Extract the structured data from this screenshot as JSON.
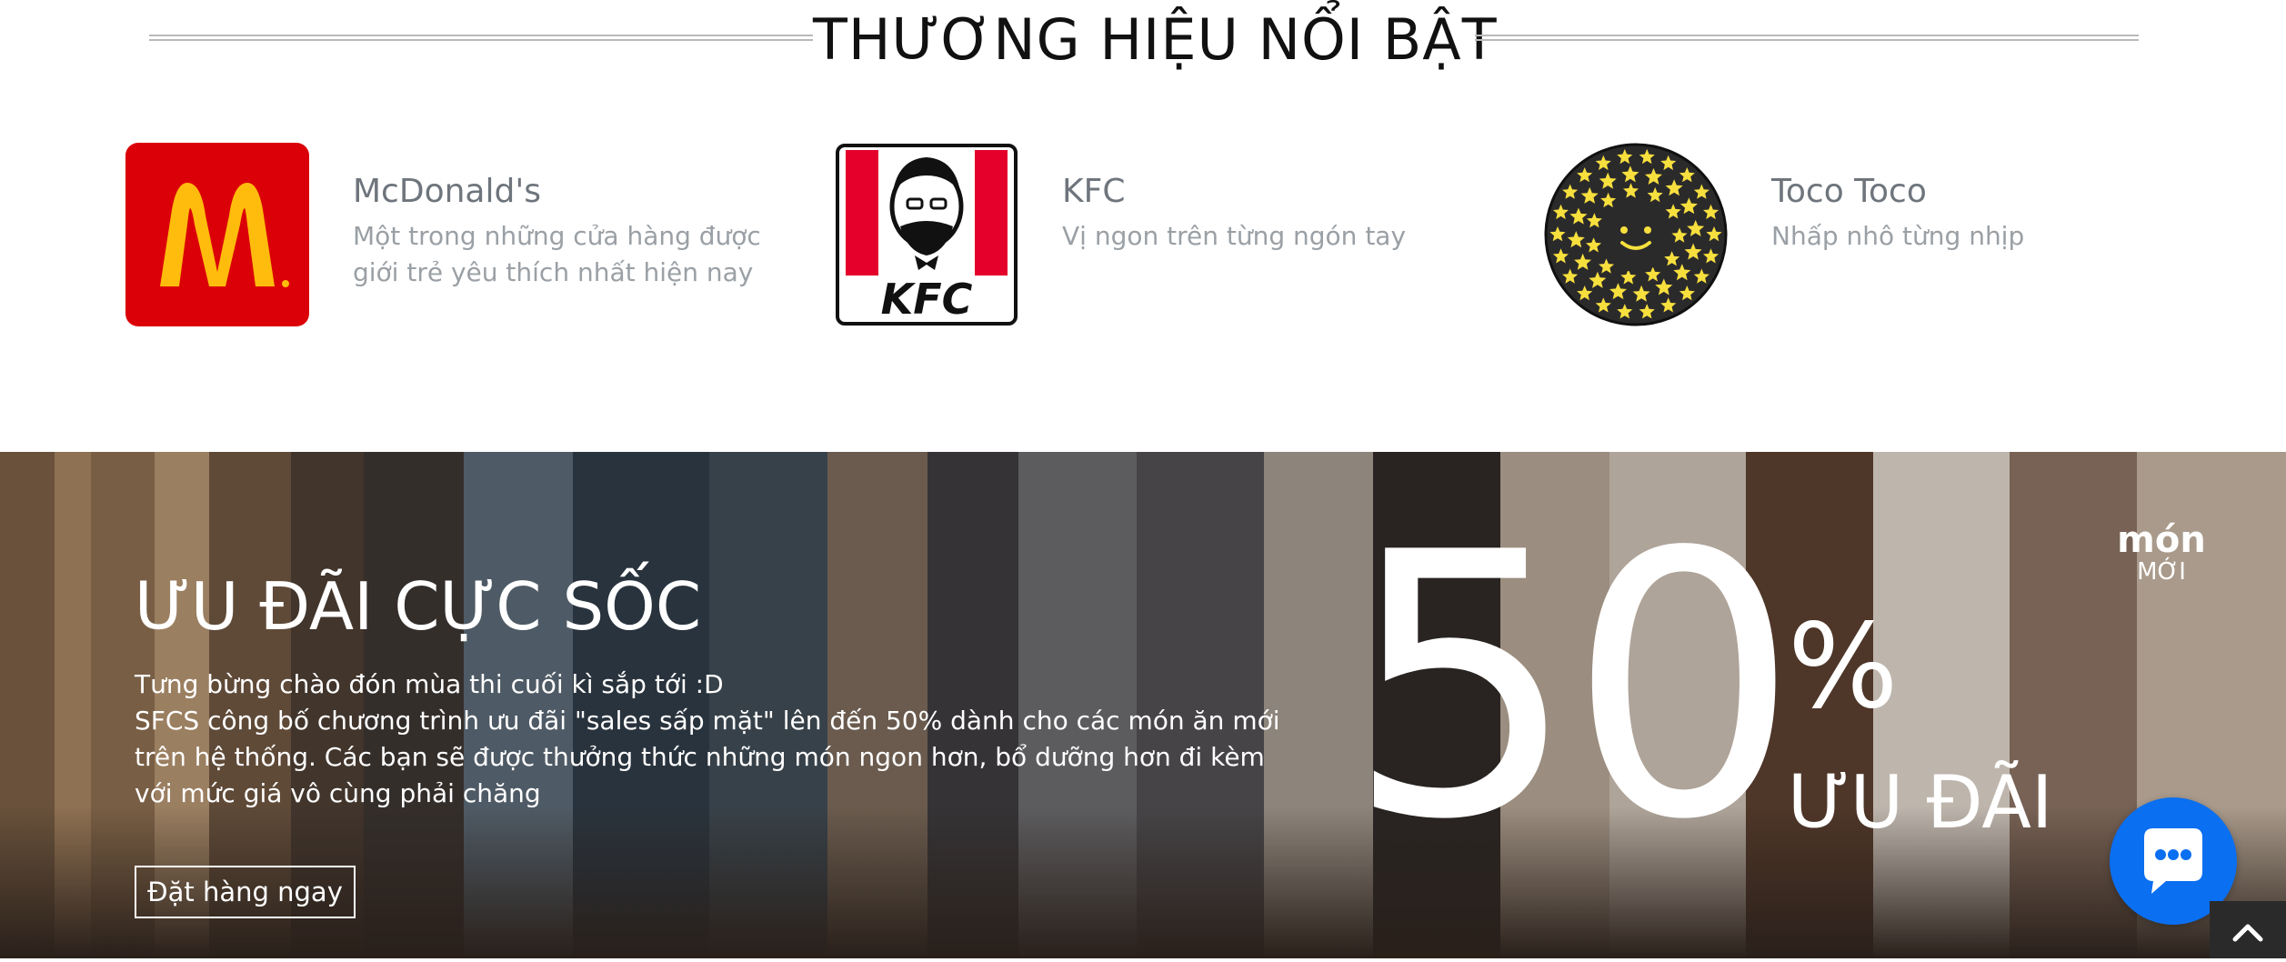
{
  "section": {
    "title": "THƯƠNG HIỆU NỔI BẬT"
  },
  "brands": [
    {
      "name": "McDonald's",
      "description": "Một trong những cửa hàng được giới trẻ yêu thích nhất hiện nay",
      "logo_icon": "mcdonalds-logo",
      "logo_text": ""
    },
    {
      "name": "KFC",
      "description": "Vị ngon trên từng ngón tay",
      "logo_icon": "kfc-logo",
      "logo_text": "KFC"
    },
    {
      "name": "Toco Toco",
      "description": "Nhấp nhô từng nhịp",
      "logo_icon": "toco-toco-logo",
      "logo_text": ""
    }
  ],
  "promo": {
    "title": "ƯU ĐÃI CỰC SỐC",
    "line1": "Tưng bừng chào đón mùa thi cuối kì sắp tới :D",
    "line2": "SFCS công bố chương trình ưu đãi \"sales sấp mặt\" lên đến 50% dành cho các món ăn mới trên hệ thống. Các bạn sẽ được thưởng thức những món ngon hơn, bổ dưỡng hơn đi kèm với mức giá vô cùng phải chăng",
    "button_label": "Đặt hàng ngay",
    "big_number": "50",
    "percent_sign": "%",
    "discount_label": "ƯU ĐÃI",
    "badge_top": "món",
    "badge_bottom": "MỚI"
  },
  "widgets": {
    "chat_icon": "chat-bubble-icon",
    "scroll_top_icon": "chevron-up-icon"
  },
  "colors": {
    "mcdonalds_red": "#db0007",
    "mcdonalds_yellow": "#ffbc0d",
    "kfc_red": "#e4002b",
    "toco_dark": "#2b2a2b",
    "toco_star": "#f7df3e",
    "chat_blue": "#0a6ff0"
  }
}
